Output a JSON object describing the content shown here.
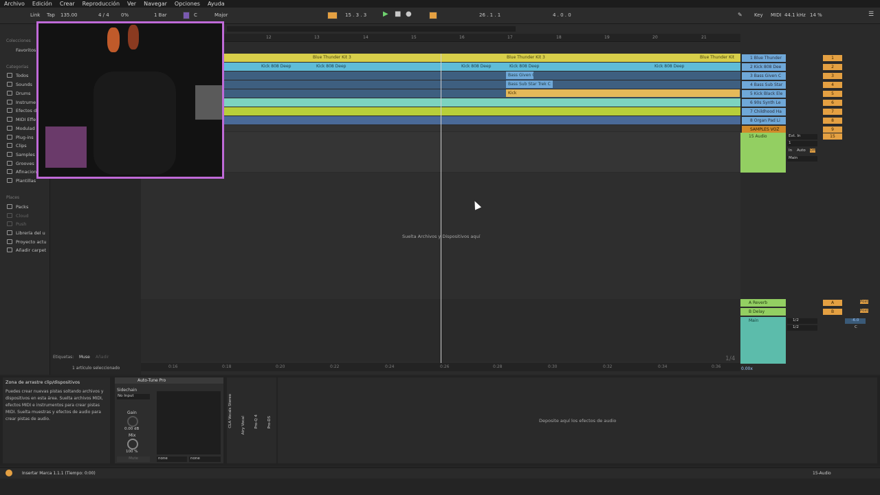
{
  "menu": [
    "Archivo",
    "Edición",
    "Crear",
    "Reproducción",
    "Ver",
    "Navegar",
    "Opciones",
    "Ayuda"
  ],
  "control": {
    "link": "Link",
    "tap": "Tap",
    "tempo": "135.00",
    "signature": "4 / 4",
    "groove_pct": "0%",
    "quant": "1 Bar",
    "key": "C",
    "scale": "Major",
    "position": "15 . 3 . 3",
    "loop_start": "26 . 1 . 1",
    "loop_len": "4 . 0 . 0",
    "key_label": "Key",
    "midi_label": "MIDI",
    "sample_rate": "44.1 kHz",
    "cpu": "14 %"
  },
  "browser": {
    "colecciones": "Colecciones",
    "favoritos": "Favoritos",
    "categorias": "Categorías",
    "items": [
      "Todos",
      "Sounds",
      "Drums",
      "Instrume",
      "Efectos d",
      "MIDI Effe",
      "Modulad",
      "Plug-ins",
      "Clips",
      "Samples",
      "Grooves",
      "Afinacion",
      "Plantillas"
    ],
    "places": "Places",
    "place_items": [
      "Packs",
      "Cloud",
      "Push",
      "Librería del u",
      "Proyecto actu",
      "Añadir carpet"
    ]
  },
  "ruler": [
    "12",
    "13",
    "14",
    "15",
    "16",
    "17",
    "18",
    "19",
    "20",
    "21"
  ],
  "clips": {
    "thunder1": "Blue Thunder Kit 3",
    "thunder2": "Blue Thunder Kit 3",
    "thunder3": "Blue Thunder Kit",
    "kick808": "Kick 808 Deep",
    "bass_given": "Bass Given C",
    "bass_sub": "Bass Sub Star Trek C",
    "kick": "Kick"
  },
  "drop_hint": "Suelta Archivos y Dispositivos aquí",
  "tracks": [
    {
      "name": "1 Blue Thunder",
      "num": "1"
    },
    {
      "name": "2 Kick 808 Dee",
      "num": "2"
    },
    {
      "name": "3 Bass Given C",
      "num": "3"
    },
    {
      "name": "4 Bass Sub Star",
      "num": "4"
    },
    {
      "name": "5 Kick Black Ele",
      "num": "5"
    },
    {
      "name": "6 90s Synth Le",
      "num": "6"
    },
    {
      "name": "7 Childhood Ha",
      "num": "7"
    },
    {
      "name": "8 Organ Pad Li",
      "num": "8"
    },
    {
      "name": "SAMPLES VOZ",
      "num": "9"
    },
    {
      "name": "15 Audio",
      "num": "15"
    }
  ],
  "audio_io": {
    "input": "Ext. In",
    "ch": "1",
    "monitor_in": "In",
    "monitor_auto": "Auto",
    "monitor_off": "Off",
    "out": "Main"
  },
  "returns": [
    {
      "name": "A Reverb",
      "num": "A",
      "post": "Post"
    },
    {
      "name": "B Delay",
      "num": "B",
      "post": "Post"
    }
  ],
  "master": {
    "name": "Main",
    "out1": "1/2",
    "out2": "1/2",
    "value": "-6.0",
    "cue": "C"
  },
  "time_marks": [
    "0:16",
    "0:18",
    "0:20",
    "0:22",
    "0:24",
    "0:26",
    "0:28",
    "0:30",
    "0:32",
    "0:34",
    "0:36"
  ],
  "page_indicator": "1/4",
  "zoom": "0.00x",
  "tags": {
    "label": "Etiquetas:",
    "muse": "Muse",
    "add": "Añadir"
  },
  "selected_count": "1 artículo seleccionado",
  "info": {
    "title": "Zona de arrastre clip/dispositivos",
    "body": "Puedes crear nuevas pistas soltando archivos y dispositivos en esta área. Suelta archivos MIDI, efectos MIDI e instrumentos para crear pistas MIDI. Suelta muestras y efectos de audio para crear pistas de audio."
  },
  "device": {
    "name": "Auto-Tune Pro",
    "sidechain": "Sidechain",
    "no_input": "No Input",
    "gain": "Gain",
    "gain_val": "0.00 dB",
    "mix": "Mix",
    "mix_val": "100 %",
    "mute": "Mute",
    "none1": "none",
    "none2": "none"
  },
  "chain": [
    "CLA Vocals Stereo",
    "Airy Vocal",
    "Pro-Q 4",
    "Pro-DS"
  ],
  "fx_drop": "Deposite aquí los efectos de audio",
  "status_text": "Insertar Marca 1.1.1 (Tiempo: 0:00)",
  "status_track": "15-Audio",
  "colors": {
    "thunder": "#d8cf4a",
    "kick808": "#5fbcd8",
    "bass": "#4f86b0",
    "kick": "#e4b95a",
    "synth": "#7dd3c0",
    "childhood": "#b8cf3a",
    "organ": "#4a6a98",
    "samples": "#d08a2a",
    "audio": "#93cf62",
    "return": "#93cf62",
    "master": "#5cbcab"
  }
}
